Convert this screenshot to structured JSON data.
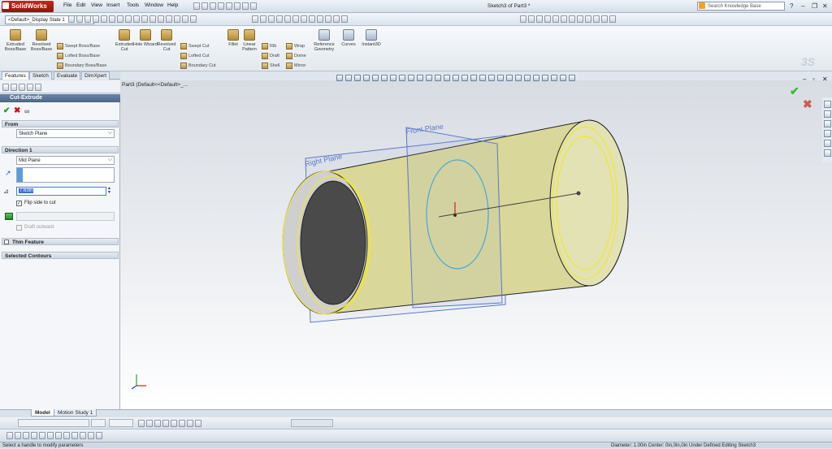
{
  "app": {
    "brand": "SolidWorks",
    "window_title": "Sketch3 of Part3 *"
  },
  "menu": [
    "File",
    "Edit",
    "View",
    "Insert",
    "Tools",
    "Window",
    "Help"
  ],
  "search": {
    "placeholder": "Search Knowledge Base"
  },
  "config": {
    "value": "<Default>_Display State 1"
  },
  "commands": {
    "extruded_boss": "Extruded Boss/Base",
    "revolved_boss": "Revolved Boss/Base",
    "swept_boss": "Swept Boss/Base",
    "lofted_boss": "Lofted Boss/Base",
    "boundary_boss": "Boundary Boss/Base",
    "extruded_cut": "Extruded Cut",
    "hole_wizard": "Hole Wizard",
    "revolved_cut": "Revolved Cut",
    "swept_cut": "Swept Cut",
    "lofted_cut": "Lofted Cut",
    "boundary_cut": "Boundary Cut",
    "fillet": "Fillet",
    "linear_pattern": "Linear Pattern",
    "rib": "Rib",
    "draft": "Draft",
    "shell": "Shell",
    "wrap": "Wrap",
    "dome": "Dome",
    "mirror": "Mirror",
    "reference_geometry": "Reference Geometry",
    "curves": "Curves",
    "instant3d": "Instant3D"
  },
  "tabs": [
    "Features",
    "Sketch",
    "Evaluate",
    "DimXpert"
  ],
  "property_manager": {
    "title": "Cut-Extrude",
    "from": {
      "header": "From",
      "value": "Sketch Plane"
    },
    "direction1": {
      "header": "Direction 1",
      "end_condition": "Mid Plane",
      "depth": "7.63in",
      "flip_side": "Flip side to cut",
      "draft_outward": "Draft outward"
    },
    "thin_feature": "Thin Feature",
    "selected_contours": "Selected Contours"
  },
  "viewport": {
    "tree_node": "Part3  (Default<<Default>_...",
    "plane_front": "Front Plane",
    "plane_right": "Right Plane"
  },
  "bottom_tabs": [
    "Model",
    "Motion Study 1"
  ],
  "status": {
    "left": "Select a handle to modify parameters",
    "right": "Diameter: 1.00in  Center: 0in,0in,0in   Under Defined    Editing Sketch3"
  },
  "colors": {
    "model": "#d9d79a",
    "sketch_yellow": "#f0e638",
    "sketch_blue": "#4aa6d8",
    "plane": "#5b78c8",
    "title_red": "#b81e14"
  }
}
